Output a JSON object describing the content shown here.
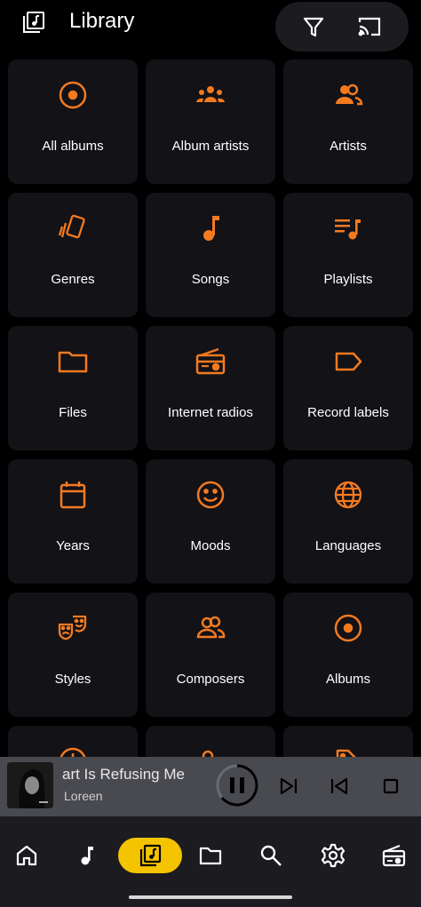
{
  "header": {
    "title": "Library"
  },
  "tiles": [
    {
      "label": "All albums"
    },
    {
      "label": "Album artists"
    },
    {
      "label": "Artists"
    },
    {
      "label": "Genres"
    },
    {
      "label": "Songs"
    },
    {
      "label": "Playlists"
    },
    {
      "label": "Files"
    },
    {
      "label": "Internet radios"
    },
    {
      "label": "Record labels"
    },
    {
      "label": "Years"
    },
    {
      "label": "Moods"
    },
    {
      "label": "Languages"
    },
    {
      "label": "Styles"
    },
    {
      "label": "Composers"
    },
    {
      "label": "Albums"
    }
  ],
  "now_playing": {
    "title": "art Is Refusing Me",
    "artist": "Loreen",
    "state": "playing"
  },
  "colors": {
    "accent": "#f47a20",
    "nav_active": "#f5c400",
    "tile_bg": "#121217"
  },
  "nav": [
    {
      "icon": "home-icon"
    },
    {
      "icon": "music-note-icon"
    },
    {
      "icon": "library-icon",
      "active": true
    },
    {
      "icon": "folder-icon"
    },
    {
      "icon": "search-icon"
    },
    {
      "icon": "settings-icon"
    },
    {
      "icon": "radio-icon"
    }
  ]
}
